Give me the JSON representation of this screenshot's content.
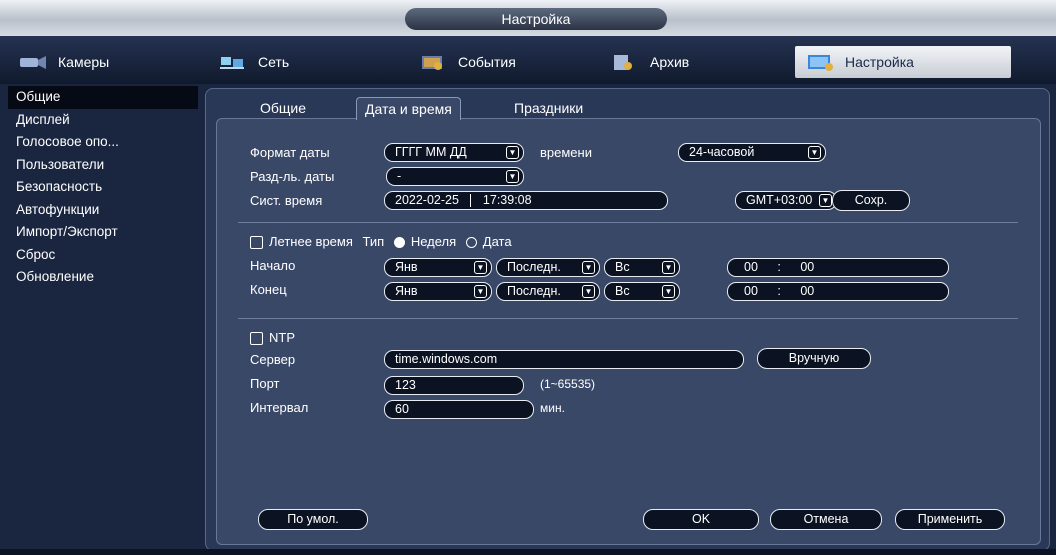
{
  "window": {
    "title": "Настройка"
  },
  "main_tabs": [
    {
      "label": "Камеры",
      "icon": "camera-icon"
    },
    {
      "label": "Сеть",
      "icon": "network-icon"
    },
    {
      "label": "События",
      "icon": "events-icon"
    },
    {
      "label": "Архив",
      "icon": "archive-icon"
    },
    {
      "label": "Настройка",
      "icon": "settings-icon"
    }
  ],
  "sidebar": {
    "items": [
      "Общие",
      "Дисплей",
      "Голосовое опо...",
      "Пользователи",
      "Безопасность",
      "Автофункции",
      "Импорт/Экспорт",
      "Сброс",
      "Обновление"
    ]
  },
  "subtabs": [
    "Общие",
    "Дата и время",
    "Праздники"
  ],
  "datetime": {
    "date_format_label": "Формат даты",
    "date_format_value": "ГГГГ ММ ДД",
    "time_format_label": "времени",
    "time_format_value": "24-часовой",
    "separator_label": "Разд-ль. даты",
    "separator_value": "-",
    "systime_label": "Сист. время",
    "systime_date": "2022-02-25",
    "systime_time": "17:39:08",
    "timezone_value": "GMT+03:00",
    "save_label": "Сохр."
  },
  "dst": {
    "label": "Летнее время",
    "type_label": "Тип",
    "week_label": "Неделя",
    "date_label": "Дата",
    "start_label": "Начало",
    "end_label": "Конец",
    "start": {
      "month": "Янв",
      "week": "Последн.",
      "day": "Вс",
      "hh": "00",
      "mm": "00",
      "sep": ":"
    },
    "end": {
      "month": "Янв",
      "week": "Последн.",
      "day": "Вс",
      "hh": "00",
      "mm": "00",
      "sep": ":"
    }
  },
  "ntp": {
    "label": "NTP",
    "server_label": "Сервер",
    "server_value": "time.windows.com",
    "manual_label": "Вручную",
    "port_label": "Порт",
    "port_value": "123",
    "port_hint": "(1~65535)",
    "interval_label": "Интервал",
    "interval_value": "60",
    "interval_unit": "мин."
  },
  "footer": {
    "default_label": "По умол.",
    "ok_label": "OK",
    "cancel_label": "Отмена",
    "apply_label": "Применить"
  },
  "colors": {
    "background": "#1a2640",
    "panel": "#2a3858",
    "field": "#0b1322",
    "accent_active_tab": "#e8ebf0"
  }
}
